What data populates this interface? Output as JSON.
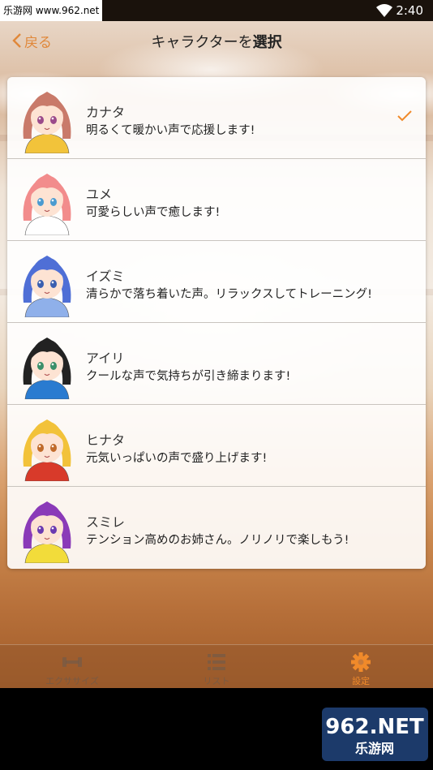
{
  "status_bar": {
    "watermark": "乐游网 www.962.net",
    "time": "2:40"
  },
  "header": {
    "back_label": "戻る",
    "title_prefix": "キャラクターを",
    "title_bold": "選択"
  },
  "characters": [
    {
      "name": "カナタ",
      "description": "明るくて暖かい声で応援します!",
      "selected": true,
      "hair": "#c97a6a",
      "shirt": "#f2c33a",
      "eyes": "#9b4a8a"
    },
    {
      "name": "ユメ",
      "description": "可愛らしい声で癒します!",
      "selected": false,
      "hair": "#f28c8c",
      "shirt": "#ffffff",
      "eyes": "#4a9bd0"
    },
    {
      "name": "イズミ",
      "description": "清らかで落ち着いた声。リラックスしてトレーニング!",
      "selected": false,
      "hair": "#4f6fd6",
      "shirt": "#8fb0ea",
      "eyes": "#3a5fb0"
    },
    {
      "name": "アイリ",
      "description": "クールな声で気持ちが引き締まります!",
      "selected": false,
      "hair": "#222222",
      "shirt": "#2a7bd0",
      "eyes": "#3a8f6a"
    },
    {
      "name": "ヒナタ",
      "description": "元気いっぱいの声で盛り上げます!",
      "selected": false,
      "hair": "#f2c23a",
      "shirt": "#d83a2a",
      "eyes": "#c06a2a"
    },
    {
      "name": "スミレ",
      "description": "テンション高めのお姉さん。ノリノリで楽しもう!",
      "selected": false,
      "hair": "#8a3ab8",
      "shirt": "#f2dc3a",
      "eyes": "#6a3ab0"
    }
  ],
  "tabs": [
    {
      "label": "エクササイズ",
      "icon": "dumbbell-icon"
    },
    {
      "label": "リスト",
      "icon": "list-icon"
    },
    {
      "label": "設定",
      "icon": "gear-icon"
    }
  ],
  "watermark_bottom": {
    "brand": "962.NET",
    "sub": "乐游网"
  },
  "colors": {
    "accent": "#f08a2a",
    "back": "#e0883a"
  }
}
